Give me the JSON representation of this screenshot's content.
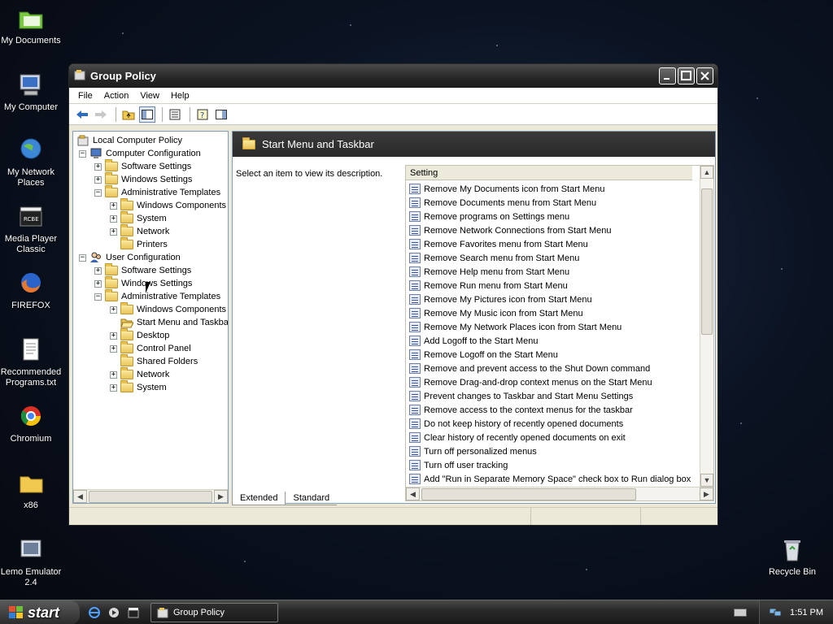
{
  "desktop": {
    "icons": [
      {
        "label": "My Documents"
      },
      {
        "label": "My Computer"
      },
      {
        "label": "My Network Places"
      },
      {
        "label": "Media Player Classic"
      },
      {
        "label": "FIREFOX"
      },
      {
        "label": "Recommended Programs.txt"
      },
      {
        "label": "Chromium"
      },
      {
        "label": "x86"
      },
      {
        "label": "Lemo Emulator 2.4"
      },
      {
        "label": "Recycle Bin"
      }
    ]
  },
  "window": {
    "title": "Group Policy",
    "menu": [
      "File",
      "Action",
      "View",
      "Help"
    ]
  },
  "tree": [
    {
      "label": "Local Computer Policy"
    },
    {
      "label": "Computer Configuration"
    },
    {
      "label": "Software Settings"
    },
    {
      "label": "Windows Settings"
    },
    {
      "label": "Administrative Templates"
    },
    {
      "label": "Windows Components"
    },
    {
      "label": "System"
    },
    {
      "label": "Network"
    },
    {
      "label": "Printers"
    },
    {
      "label": "User Configuration"
    },
    {
      "label": "Software Settings"
    },
    {
      "label": "Windows Settings"
    },
    {
      "label": "Administrative Templates"
    },
    {
      "label": "Windows Components"
    },
    {
      "label": "Start Menu and Taskbar"
    },
    {
      "label": "Desktop"
    },
    {
      "label": "Control Panel"
    },
    {
      "label": "Shared Folders"
    },
    {
      "label": "Network"
    },
    {
      "label": "System"
    }
  ],
  "details": {
    "header": "Start Menu and Taskbar",
    "description": "Select an item to view its description.",
    "column": "Setting",
    "settings": [
      "Remove My Documents icon from Start Menu",
      "Remove Documents menu from Start Menu",
      "Remove programs on Settings menu",
      "Remove Network Connections from Start Menu",
      "Remove Favorites menu from Start Menu",
      "Remove Search menu from Start Menu",
      "Remove Help menu from Start Menu",
      "Remove Run menu from Start Menu",
      "Remove My Pictures icon from Start Menu",
      "Remove My Music icon from Start Menu",
      "Remove My Network Places icon from Start Menu",
      "Add Logoff to the Start Menu",
      "Remove Logoff on the Start Menu",
      "Remove and prevent access to the Shut Down command",
      "Remove Drag-and-drop context menus on the Start Menu",
      "Prevent changes to Taskbar and Start Menu Settings",
      "Remove access to the context menus for the taskbar",
      "Do not keep history of recently opened documents",
      "Clear history of recently opened documents on exit",
      "Turn off personalized menus",
      "Turn off user tracking",
      "Add \"Run in Separate Memory Space\" check box to Run dialog box"
    ],
    "tabs": [
      "Extended",
      "Standard"
    ]
  },
  "taskbar": {
    "start_label": "start",
    "task_label": "Group Policy",
    "clock": "1:51 PM"
  },
  "colors": {
    "titlebar": "#262626",
    "pane_header": "#2a2a2a",
    "folder": "#e8c458"
  }
}
